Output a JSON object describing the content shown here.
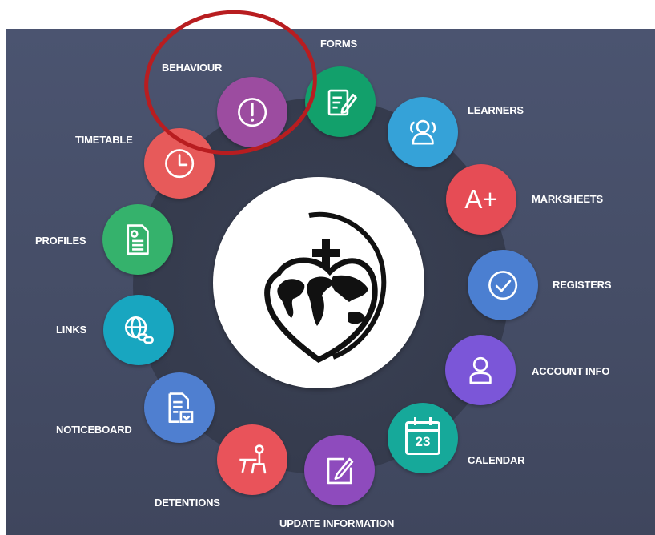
{
  "menu": {
    "items": [
      {
        "key": "forms",
        "label": "FORMS",
        "icon": "forms-icon",
        "color": "#12a06b"
      },
      {
        "key": "learners",
        "label": "LEARNERS",
        "icon": "people-icon",
        "color": "#35a2d8"
      },
      {
        "key": "marksheets",
        "label": "MARKSHEETS",
        "icon": "grade-a-plus-icon",
        "color": "#e64c55",
        "glyph": "A+"
      },
      {
        "key": "registers",
        "label": "REGISTERS",
        "icon": "check-circle-icon",
        "color": "#4b7fd1"
      },
      {
        "key": "account",
        "label": "ACCOUNT INFO",
        "icon": "user-icon",
        "color": "#7b56d8"
      },
      {
        "key": "calendar",
        "label": "CALENDAR",
        "icon": "calendar-icon",
        "color": "#16a99a",
        "glyph": "23"
      },
      {
        "key": "update",
        "label": "UPDATE INFORMATION",
        "icon": "edit-icon",
        "color": "#8e4bbd"
      },
      {
        "key": "detentions",
        "label": "DETENTIONS",
        "icon": "desk-icon",
        "color": "#e9535a"
      },
      {
        "key": "noticeboard",
        "label": "NOTICEBOARD",
        "icon": "notice-document-icon",
        "color": "#4f7fd0"
      },
      {
        "key": "links",
        "label": "LINKS",
        "icon": "globe-link-icon",
        "color": "#18a6c0"
      },
      {
        "key": "profiles",
        "label": "PROFILES",
        "icon": "profile-document-icon",
        "color": "#35b26c"
      },
      {
        "key": "timetable",
        "label": "TIMETABLE",
        "icon": "clock-icon",
        "color": "#e75a5a"
      },
      {
        "key": "behaviour",
        "label": "BEHAVIOUR",
        "icon": "alert-icon",
        "color": "#9c4ca0"
      }
    ]
  },
  "highlight": {
    "color": "#b81d20",
    "target": "behaviour"
  },
  "logo": {
    "icon": "world-heart-logo"
  }
}
